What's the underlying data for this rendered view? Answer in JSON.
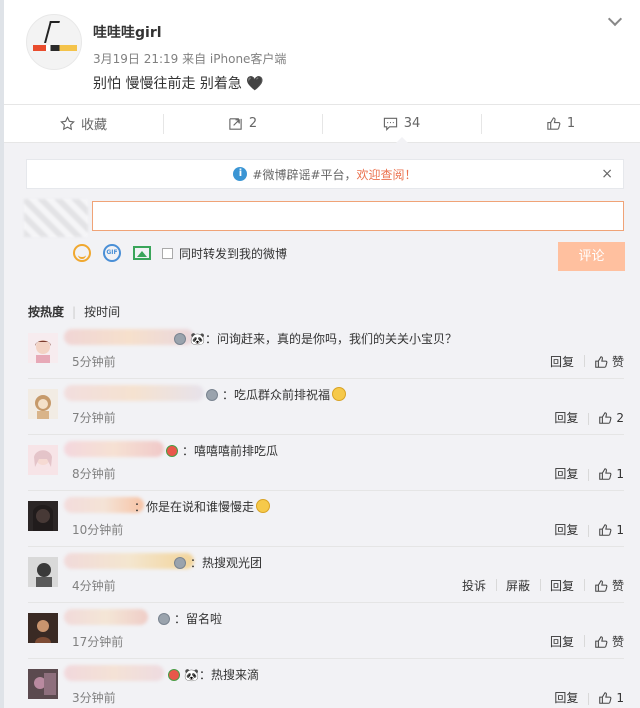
{
  "post": {
    "author": "哇哇哇girl",
    "meta": "3月19日 21:19 来自 iPhone客户端",
    "text": "别怕 慢慢往前走 别着急 🖤"
  },
  "actions": {
    "favorite": "收藏",
    "repost": "2",
    "comment": "34",
    "like": "1"
  },
  "notice": {
    "text": "#微博辟谣#平台，",
    "link": "欢迎查阅！",
    "close": "×"
  },
  "composer": {
    "repost_label": "同时转发到我的微博",
    "submit": "评论"
  },
  "sort": {
    "hot": "按热度",
    "time": "按时间"
  },
  "ops": {
    "reply": "回复",
    "like": "赞",
    "report": "投诉",
    "block": "屏蔽"
  },
  "comments": [
    {
      "text": "🐼：问询赶来，真的是你吗，我们的关关小宝贝？",
      "time": "5分钟前",
      "likes": "赞"
    },
    {
      "text": "：吃瓜群众前排祝福",
      "time": "7分钟前",
      "likes": "2"
    },
    {
      "text": "：嘻嘻嘻前排吃瓜",
      "time": "8分钟前",
      "likes": "1"
    },
    {
      "text": "：你是在说和谁慢慢走",
      "time": "10分钟前",
      "likes": "1"
    },
    {
      "text": "：热搜观光团",
      "time": "4分钟前",
      "likes": "赞"
    },
    {
      "text": "：留名啦",
      "time": "17分钟前",
      "likes": "赞"
    },
    {
      "text": "🐼：热搜来滴",
      "time": "3分钟前",
      "likes": "1"
    }
  ],
  "colors": {
    "accent": "#eb7350",
    "submit_bg": "#ffc09f",
    "input_border": "#f0a377",
    "notice_info": "#3a95d4",
    "area_bg": "#f2f2f5"
  }
}
